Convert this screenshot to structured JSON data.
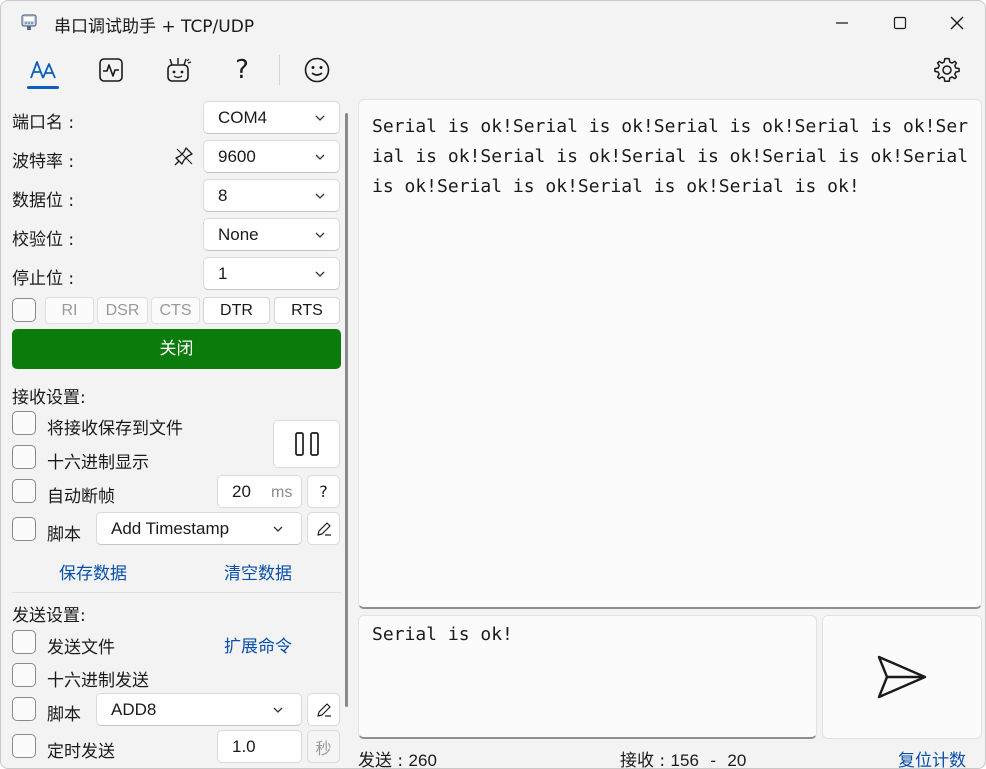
{
  "window": {
    "title": "串口调试助手 + TCP/UDP"
  },
  "toolbar": {
    "icons": [
      "text-mode-icon",
      "waveform-icon",
      "plugin-icon",
      "help-icon",
      "smiley-icon",
      "settings-icon"
    ],
    "help_glyph": "?"
  },
  "serial": {
    "port_label": "端口名 :",
    "port_value": "COM4",
    "baud_label": "波特率 :",
    "baud_value": "9600",
    "databits_label": "数据位 :",
    "databits_value": "8",
    "parity_label": "校验位 :",
    "parity_value": "None",
    "stopbits_label": "停止位 :",
    "stopbits_value": "1",
    "pins": [
      "RI",
      "DSR",
      "CTS",
      "DTR",
      "RTS"
    ],
    "open_close_label": "关闭"
  },
  "receive_settings": {
    "header": "接收设置:",
    "save_to_file": "将接收保存到文件",
    "hex_display": "十六进制显示",
    "auto_frame": "自动断帧",
    "frame_value": "20",
    "frame_unit": "ms",
    "frame_help": "?",
    "script_label": "脚本",
    "script_value": "Add Timestamp",
    "save_data": "保存数据",
    "clear_data": "清空数据"
  },
  "send_settings": {
    "header": "发送设置:",
    "send_file": "发送文件",
    "ext_cmd": "扩展命令",
    "hex_send": "十六进制发送",
    "script_label": "脚本",
    "script_value": "ADD8",
    "timed_send": "定时发送",
    "timed_value": "1.0",
    "timed_unit": "秒"
  },
  "receive_area": {
    "text": "Serial is ok!Serial is ok!Serial is ok!Serial is ok!Serial is ok!Serial is ok!Serial is ok!Serial is ok!Serial is ok!Serial is ok!Serial is ok!Serial is ok!"
  },
  "send_area": {
    "text": "Serial is ok!"
  },
  "status_bar": {
    "sent_label": "发送 :",
    "sent_value": "260",
    "recv_label": "接收 :",
    "recv_value": "156",
    "recv_sep": "-",
    "recv_extra": "20",
    "reset_label": "复位计数"
  },
  "colors": {
    "accent": "#0a60b8",
    "open_button": "#0b7b0b",
    "link": "#0a4fa8"
  }
}
